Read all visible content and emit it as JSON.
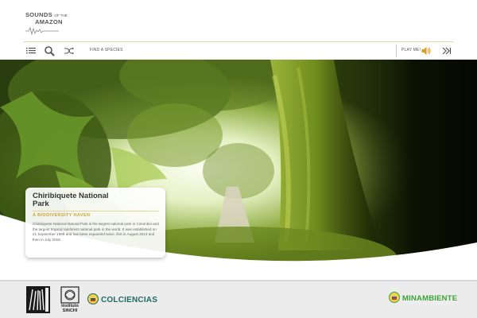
{
  "app": {
    "logo_line1": "SOUNDS",
    "logo_line1_small": "OF THE",
    "logo_line2": "AMAZON"
  },
  "toolbar": {
    "find_label": "FIND A SPECIES",
    "play_label": "PLAY ME!",
    "icons": [
      "list-icon",
      "search-icon",
      "shuffle-icon",
      "speaker-icon",
      "skip-forward-icon"
    ]
  },
  "card": {
    "title": "Chiribiquete National Park",
    "subtitle": "A BIODIVERSITY HAVEN",
    "body": "Chiribiquete National Natural Park is the largest national park in Colombia and the largest tropical rainforest national park in the world. It was established on 21 September 1989 and has been expanded twice, first in August 2013 and then in July 2018."
  },
  "footer": {
    "sinchi_label": "Instituto SINCHI",
    "colciencias_label": "COLCIENCIAS",
    "minambiente_label": "MINAMBIENTE"
  },
  "colors": {
    "accent_gold": "#c8a63c",
    "speaker_orange": "#e39b1c",
    "colciencias_teal": "#1f6b62",
    "minambiente_green": "#3aa33a"
  }
}
